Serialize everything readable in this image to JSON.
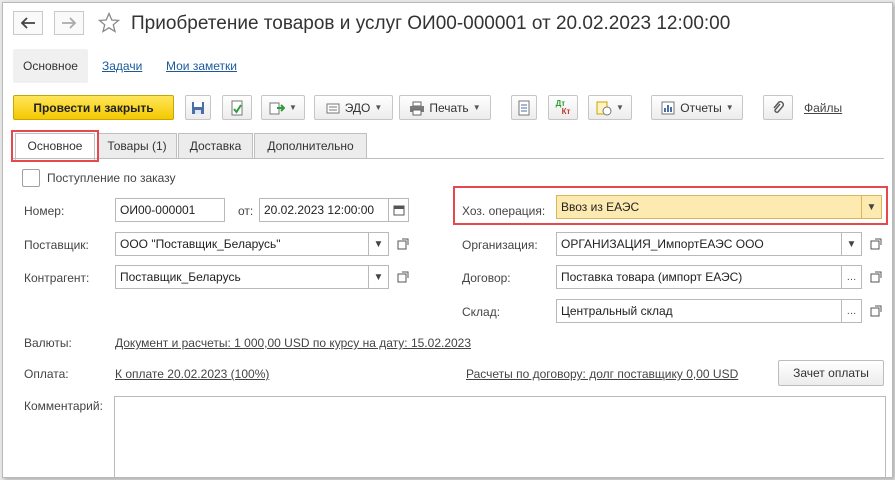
{
  "window": {
    "title": "Приобретение товаров и услуг ОИ00-000001 от 20.02.2023 12:00:00"
  },
  "top_tabs": [
    {
      "label": "Основное"
    },
    {
      "label": "Задачи"
    },
    {
      "label": "Мои заметки"
    }
  ],
  "toolbar": {
    "post_close": "Провести и закрыть",
    "edo": "ЭДО",
    "print": "Печать",
    "reports": "Отчеты",
    "files": "Файлы",
    "dtkt_top": "Дт",
    "dtkt_bottom": "Кт"
  },
  "form_tabs": [
    {
      "label": "Основное"
    },
    {
      "label": "Товары (1)"
    },
    {
      "label": "Доставка"
    },
    {
      "label": "Дополнительно"
    }
  ],
  "form": {
    "by_order_label": "Поступление по заказу",
    "number_label": "Номер:",
    "number_value": "ОИ00-000001",
    "date_label": "от:",
    "date_value": "20.02.2023 12:00:00",
    "supplier_label": "Поставщик:",
    "supplier_value": "ООО \"Поставщик_Беларусь\"",
    "counterparty_label": "Контрагент:",
    "counterparty_value": "Поставщик_Беларусь",
    "operation_label": "Хоз. операция:",
    "operation_value": "Ввоз из ЕАЭС",
    "org_label": "Организация:",
    "org_value": "ОРГАНИЗАЦИЯ_ИмпортЕАЭС ООО",
    "contract_label": "Договор:",
    "contract_value": "Поставка товара (импорт ЕАЭС)",
    "warehouse_label": "Склад:",
    "warehouse_value": "Центральный склад",
    "currency_label": "Валюты:",
    "currency_link": "Документ и расчеты: 1 000,00 USD по курсу на дату: 15.02.2023",
    "payment_label": "Оплата:",
    "payment_link": "К оплате 20.02.2023 (100%)",
    "settlement_link": "Расчеты по договору: долг поставщику 0,00 USD",
    "offset_button": "Зачет оплаты",
    "comment_label": "Комментарий:"
  },
  "colors": {
    "primary_button": "#f4c800",
    "highlight_field": "#fdeab0",
    "annotation_red": "#e5484d",
    "link": "#1b5a9a"
  }
}
